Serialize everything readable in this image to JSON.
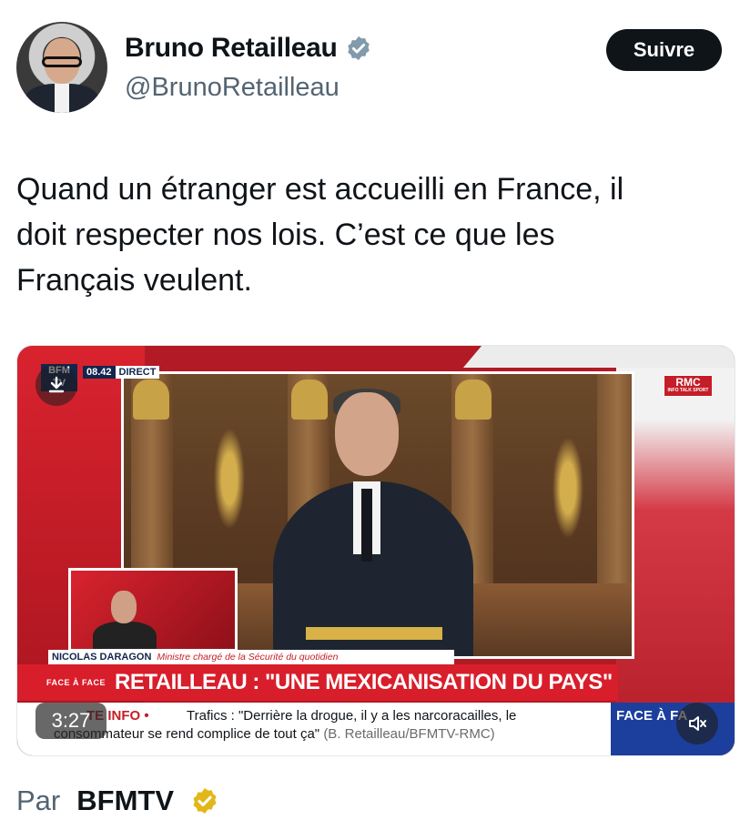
{
  "author": {
    "display_name": "Bruno Retailleau",
    "handle": "@BrunoRetailleau",
    "verified_color": "#829aab"
  },
  "follow_button": {
    "label": "Suivre"
  },
  "tweet": {
    "text": "Quand un étranger est accueilli en France, il\ndoit respecter nos lois. C’est ce que les\nFrançais veulent."
  },
  "video": {
    "duration": "3:27",
    "broadcast": {
      "channel_logo": "BFM TV",
      "time": "08.42",
      "live_tag": "DIRECT",
      "partner_logo": "RMC",
      "partner_tagline": "INFO TALK SPORT",
      "speaker_name": "NICOLAS DARAGON",
      "speaker_role": "Ministre chargé de la Sécurité du quotidien",
      "show_tag": "FACE À FACE",
      "headline": "RETAILLEAU : \"UNE MEXICANISATION DU PAYS\"",
      "ticker_alert": "TE INFO •",
      "ticker_line1": "Trafics : \"Derrière la drogue, il y a les narcoracailles, le",
      "ticker_line2": "consommateur se rend complice de tout ça\"",
      "ticker_source": "(B. Retailleau/BFMTV-RMC)",
      "show_corner": "FACE À FA"
    }
  },
  "attribution": {
    "prefix": "Par",
    "name": "BFMTV",
    "badge_color": "#e2b719"
  }
}
